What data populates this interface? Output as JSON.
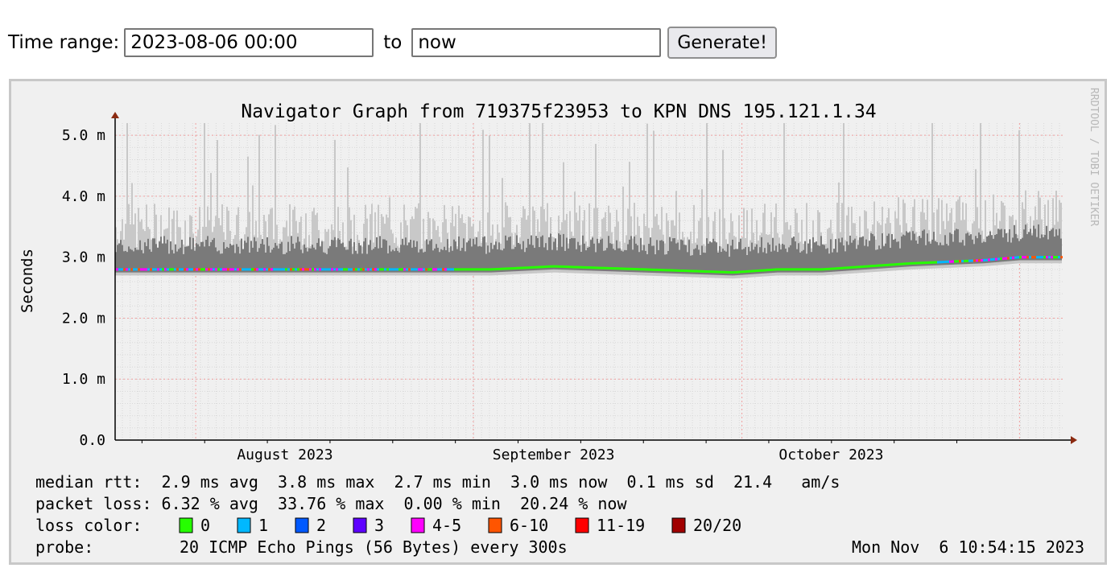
{
  "form": {
    "time_range_label": "Time range:",
    "start_value": "2023-08-06 00:00",
    "to_label": "to",
    "end_value": "now",
    "generate_label": "Generate!"
  },
  "graph": {
    "title": "Navigator Graph from 719375f23953 to KPN DNS 195.121.1.34",
    "ylabel": "Seconds",
    "watermark": "RRDTOOL / TOBI OETIKER",
    "yticks": [
      "0.0",
      "1.0 m",
      "2.0 m",
      "3.0 m",
      "4.0 m",
      "5.0 m"
    ],
    "xticks": [
      "August 2023",
      "September 2023",
      "October 2023"
    ],
    "stats": {
      "rtt_line": "median rtt:  2.9 ms avg  3.8 ms max  2.7 ms min  3.0 ms now  0.1 ms sd  21.4   am/s",
      "loss_line": "packet loss: 6.32 % avg  33.76 % max  0.00 % min  20.24 % now",
      "loss_color_label": "loss color:",
      "probe_label": "probe:",
      "probe_text": "20 ICMP Echo Pings (56 Bytes) every 300s",
      "timestamp": "Mon Nov  6 10:54:15 2023"
    },
    "legend": [
      {
        "label": "0",
        "color": "#26ff00"
      },
      {
        "label": "1",
        "color": "#00b8ff"
      },
      {
        "label": "2",
        "color": "#0059ff"
      },
      {
        "label": "3",
        "color": "#5e00ff"
      },
      {
        "label": "4-5",
        "color": "#ff00fe"
      },
      {
        "label": "6-10",
        "color": "#ff5500"
      },
      {
        "label": "11-19",
        "color": "#ff0000"
      },
      {
        "label": "20/20",
        "color": "#a10000"
      }
    ]
  },
  "chart_data": {
    "type": "line",
    "title": "Navigator Graph from 719375f23953 to KPN DNS 195.121.1.34",
    "ylabel": "Seconds",
    "xlabel": "",
    "ylim": [
      0,
      5.2
    ],
    "y_unit": "ms",
    "x_range": [
      "2023-07-23",
      "2023-11-06"
    ],
    "x_tick_labels": [
      "August 2023",
      "September 2023",
      "October 2023"
    ],
    "grid": true,
    "series": [
      {
        "name": "median rtt",
        "x": [
          "2023-07-23",
          "2023-08-01",
          "2023-08-10",
          "2023-08-20",
          "2023-08-30",
          "2023-09-03",
          "2023-09-10",
          "2023-09-20",
          "2023-09-30",
          "2023-10-05",
          "2023-10-10",
          "2023-10-20",
          "2023-10-28",
          "2023-11-01",
          "2023-11-06"
        ],
        "values": [
          2.8,
          2.8,
          2.8,
          2.8,
          2.8,
          2.8,
          2.85,
          2.8,
          2.75,
          2.8,
          2.8,
          2.9,
          2.95,
          3.0,
          3.0
        ]
      }
    ]
  }
}
